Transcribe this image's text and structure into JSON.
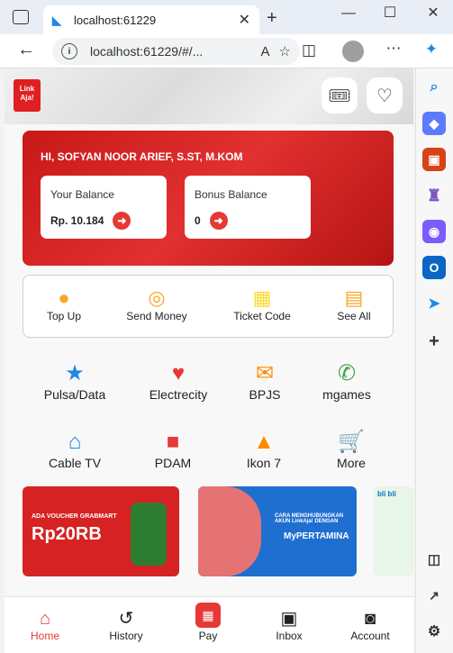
{
  "browser": {
    "tab_title": "localhost:61229",
    "url": "localhost:61229/#/...",
    "window_controls": [
      "minimize-icon",
      "maximize-icon",
      "close-icon"
    ]
  },
  "app": {
    "logo_text": "Link Aja!",
    "greeting": "HI, SOFYAN NOOR ARIEF, S.ST, M.KOM",
    "balance": {
      "label": "Your Balance",
      "value": "Rp. 10.184"
    },
    "bonus": {
      "label": "Bonus Balance",
      "value": "0"
    },
    "quick_actions": [
      {
        "label": "Top Up",
        "icon": "coin-icon"
      },
      {
        "label": "Send Money",
        "icon": "refresh-coin-icon"
      },
      {
        "label": "Ticket Code",
        "icon": "ticket-icon"
      },
      {
        "label": "See All",
        "icon": "notepad-icon"
      }
    ],
    "services": [
      {
        "label": "Pulsa/Data",
        "icon": "star-icon",
        "color": "#1e88e5"
      },
      {
        "label": "Electrecity",
        "icon": "heart-icon",
        "color": "#e53935"
      },
      {
        "label": "BPJS",
        "icon": "mail-icon",
        "color": "#fb8c00"
      },
      {
        "label": "mgames",
        "icon": "phone-icon",
        "color": "#43a047"
      },
      {
        "label": "Cable TV",
        "icon": "home-icon",
        "color": "#1e88e5"
      },
      {
        "label": "PDAM",
        "icon": "briefcase-icon",
        "color": "#e53935"
      },
      {
        "label": "Ikon 7",
        "icon": "graduation-cap-icon",
        "color": "#fb8c00"
      },
      {
        "label": "More",
        "icon": "cart-icon",
        "color": "#43a047"
      }
    ],
    "banners": [
      {
        "line1": "ADA VOUCHER GRABMART",
        "line2": "Rp20RB",
        "color": "#d62222"
      },
      {
        "line1": "CARA MENGHUBUNGKAN AKUN LinkAja! DENGAN",
        "line2": "MyPERTAMINA",
        "color": "#1f6fd1"
      },
      {
        "line1": "bli bli",
        "line2": "",
        "color": "#e8f5e9"
      }
    ],
    "nav": [
      {
        "label": "Home",
        "icon": "home-icon"
      },
      {
        "label": "History",
        "icon": "history-icon"
      },
      {
        "label": "Pay",
        "icon": "qr-icon"
      },
      {
        "label": "Inbox",
        "icon": "inbox-icon"
      },
      {
        "label": "Account",
        "icon": "account-icon"
      }
    ],
    "accent": "#e53935"
  }
}
